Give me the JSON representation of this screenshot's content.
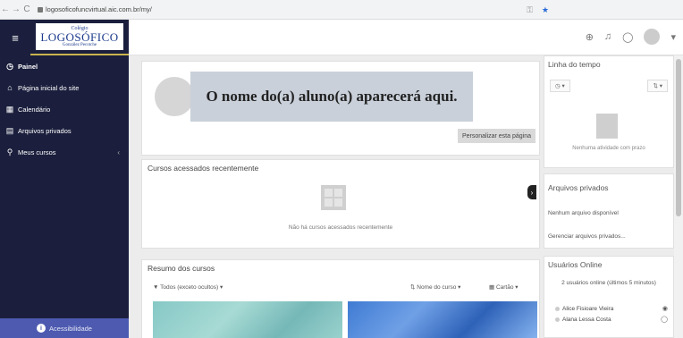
{
  "browser": {
    "back": "←",
    "forward": "→",
    "reload": "C",
    "url": "logosoficofuncvirtual.aic.com.br/my/",
    "key_icon": "key-icon",
    "star_icon": "star-icon"
  },
  "header": {
    "menu_icon": "≡",
    "logo_top": "Colégio",
    "logo_main": "LOGOSÓFICO",
    "logo_sub": "González Pecotche",
    "icons": [
      "globe-icon",
      "bell-icon",
      "chat-icon",
      "avatar"
    ]
  },
  "sidebar": {
    "items": [
      {
        "icon": "◷",
        "label": "Painel"
      },
      {
        "icon": "⌂",
        "label": "Página inicial do site"
      },
      {
        "icon": "▦",
        "label": "Calendário"
      },
      {
        "icon": "▤",
        "label": "Arquivos privados"
      },
      {
        "icon": "⚲",
        "label": "Meus cursos"
      }
    ],
    "chevron": "‹",
    "accessibility": "Acessibilidade"
  },
  "profile": {
    "name_notice": "O nome do(a) aluno(a) aparecerá aqui.",
    "customize_button": "Personalizar esta página"
  },
  "recent": {
    "title": "Cursos acessados recentemente",
    "empty": "Não há cursos acessados recentemente"
  },
  "summary": {
    "title": "Resumo dos cursos",
    "filter_all": "▼ Todos (exceto ocultos) ▾",
    "filter_name": "⇅ Nome do curso ▾",
    "filter_cards": "▦ Cartão ▾"
  },
  "timeline": {
    "title": "Linha do tempo",
    "btn_clock": "◷ ▾",
    "btn_sort": "⇅ ▾",
    "empty": "Nenhuma atividade com prazo"
  },
  "files": {
    "title": "Arquivos privados",
    "none": "Nenhum arquivo disponível",
    "manage": "Gerenciar arquivos privados..."
  },
  "users": {
    "title": "Usuários Online",
    "count": "2 usuários online (últimos 5 minutos)",
    "list": [
      {
        "name": "Alice Fisioare Vieira",
        "action": "◉"
      },
      {
        "name": "Alana Lessa Costa",
        "action": "◯"
      }
    ]
  }
}
